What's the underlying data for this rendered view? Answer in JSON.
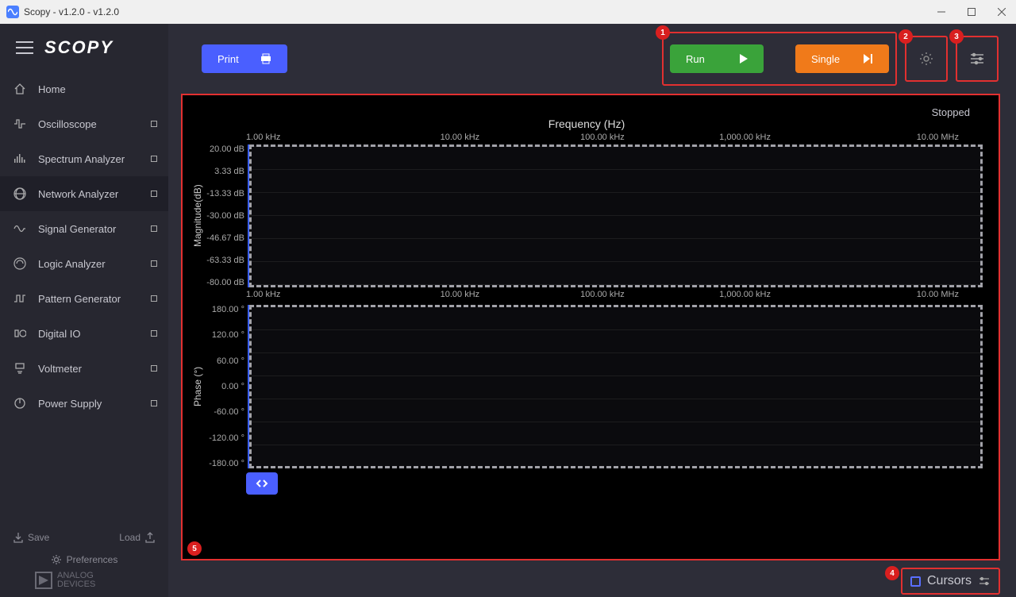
{
  "window": {
    "title": "Scopy - v1.2.0 - v1.2.0"
  },
  "logo": "SCOPY",
  "sidebar": {
    "items": [
      {
        "label": "Home",
        "icon": "home",
        "dot": false
      },
      {
        "label": "Oscilloscope",
        "icon": "osc",
        "dot": true
      },
      {
        "label": "Spectrum Analyzer",
        "icon": "spectrum",
        "dot": true
      },
      {
        "label": "Network Analyzer",
        "icon": "network",
        "dot": true,
        "active": true
      },
      {
        "label": "Signal Generator",
        "icon": "siggen",
        "dot": true
      },
      {
        "label": "Logic Analyzer",
        "icon": "logic",
        "dot": true
      },
      {
        "label": "Pattern Generator",
        "icon": "pattern",
        "dot": true
      },
      {
        "label": "Digital IO",
        "icon": "digitalio",
        "dot": true
      },
      {
        "label": "Voltmeter",
        "icon": "voltmeter",
        "dot": true
      },
      {
        "label": "Power Supply",
        "icon": "power",
        "dot": true
      }
    ],
    "save": "Save",
    "load": "Load",
    "preferences": "Preferences",
    "brand": "ANALOG\nDEVICES"
  },
  "toolbar": {
    "print": "Print",
    "run": "Run",
    "single": "Single"
  },
  "markers": [
    "1",
    "2",
    "3",
    "4",
    "5"
  ],
  "plot": {
    "status": "Stopped",
    "freq_title": "Frequency (Hz)",
    "freq_ticks": [
      "1.00 kHz",
      "10.00 kHz",
      "100.00 kHz",
      "1,000.00 kHz",
      "10.00 MHz"
    ],
    "mag_label": "Magnitude(dB)",
    "mag_ticks": [
      "20.00 dB",
      "3.33 dB",
      "-13.33 dB",
      "-30.00 dB",
      "-46.67 dB",
      "-63.33 dB",
      "-80.00 dB"
    ],
    "phase_label": "Phase (°)",
    "phase_ticks": [
      "180.00 °",
      "120.00 °",
      "60.00 °",
      "0.00 °",
      "-60.00 °",
      "-120.00 °",
      "-180.00 °"
    ]
  },
  "footer": {
    "cursors": "Cursors"
  },
  "chart_data": [
    {
      "type": "line",
      "title": "Frequency (Hz)",
      "xlabel": "Frequency (Hz)",
      "ylabel": "Magnitude(dB)",
      "x_scale": "log",
      "x_ticks": [
        1000,
        10000,
        100000,
        1000000,
        10000000
      ],
      "ylim": [
        -80,
        20
      ],
      "series": [],
      "status": "Stopped"
    },
    {
      "type": "line",
      "xlabel": "Frequency (Hz)",
      "ylabel": "Phase (°)",
      "x_scale": "log",
      "x_ticks": [
        1000,
        10000,
        100000,
        1000000,
        10000000
      ],
      "ylim": [
        -180,
        180
      ],
      "series": [],
      "status": "Stopped"
    }
  ]
}
